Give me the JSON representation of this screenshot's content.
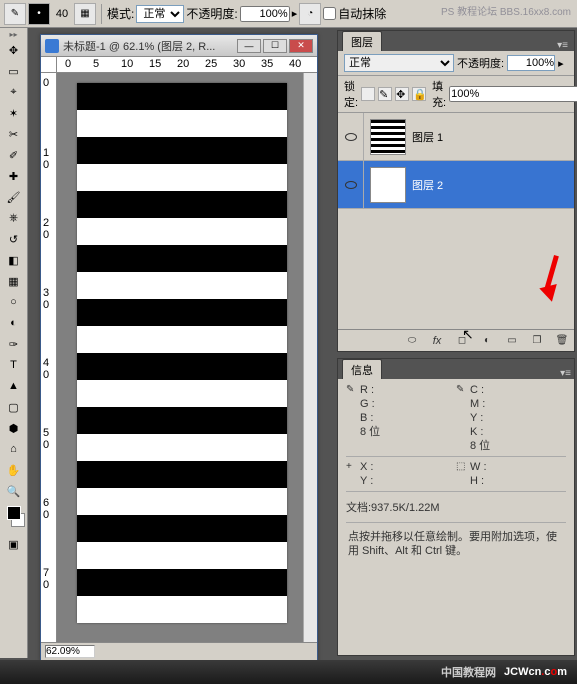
{
  "topbar": {
    "mode_label": "模式:",
    "mode_value": "正常",
    "opacity_label": "不透明度:",
    "opacity_value": "100%",
    "auto_erase_label": "自动抹除",
    "brush_size": "40"
  },
  "document": {
    "title": "未标题-1 @ 62.1% (图层 2, R...",
    "zoom": "62.09%",
    "ruler_h": [
      "0",
      "5",
      "10",
      "15",
      "20",
      "25",
      "30",
      "35",
      "40"
    ],
    "ruler_v": [
      "0",
      "10",
      "20",
      "30",
      "40",
      "50",
      "60",
      "70"
    ]
  },
  "layers_panel": {
    "tab": "图层",
    "blend_mode": "正常",
    "opacity_label": "不透明度:",
    "opacity_value": "100%",
    "lock_label": "锁定:",
    "fill_label": "填充:",
    "fill_value": "100%",
    "layers": [
      {
        "name": "图层 1",
        "visible": true,
        "selected": false,
        "thumb": "stripes"
      },
      {
        "name": "图层 2",
        "visible": true,
        "selected": true,
        "thumb": "white"
      }
    ]
  },
  "info_panel": {
    "tab": "信息",
    "rgb": {
      "R": "R :",
      "G": "G :",
      "B": "B :",
      "bits": "8 位"
    },
    "cmyk": {
      "C": "C :",
      "M": "M :",
      "Y": "Y :",
      "K": "K :",
      "bits": "8 位"
    },
    "xy": {
      "X": "X :",
      "Y": "Y :"
    },
    "wh": {
      "W": "W :",
      "H": "H :"
    },
    "doc": "文档:937.5K/1.22M",
    "hint": "点按并拖移以任意绘制。要用附加选项，使用 Shift、Alt 和 Ctrl 键。"
  },
  "watermark": {
    "top": "PS 教程论坛\nBBS.16xx8.com",
    "cn": "中国教程网",
    "site": "JCWcn.com"
  }
}
